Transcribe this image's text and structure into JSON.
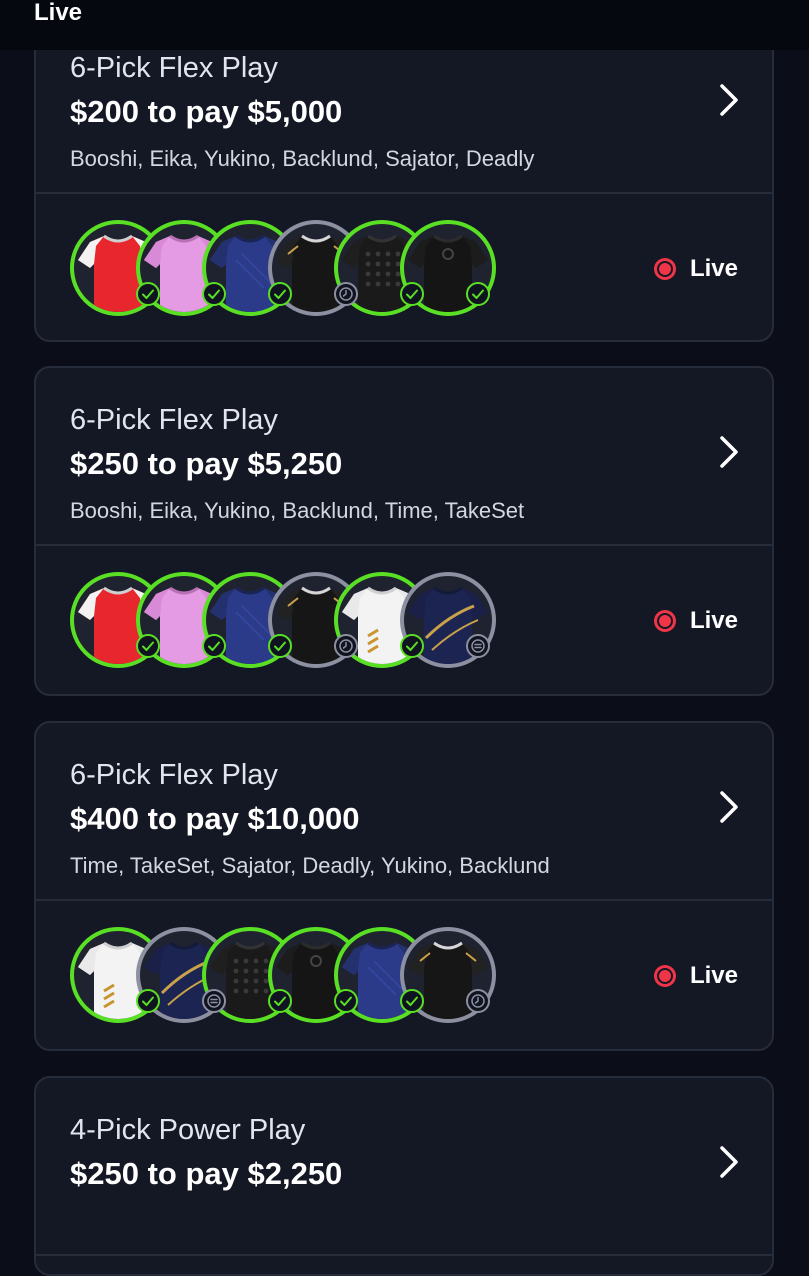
{
  "header": {
    "tab_label": "Live"
  },
  "entries": [
    {
      "play_type": "6-Pick Flex Play",
      "payout": "$200 to pay $5,000",
      "players": "Booshi, Eika, Yukino, Backlund, Sajator, Deadly",
      "status": "Live",
      "picks": [
        {
          "jersey": "red-white",
          "result": "won"
        },
        {
          "jersey": "pink",
          "result": "won"
        },
        {
          "jersey": "navy",
          "result": "won"
        },
        {
          "jersey": "black-gold",
          "result": "pending"
        },
        {
          "jersey": "black-pattern",
          "result": "won"
        },
        {
          "jersey": "black-circle",
          "result": "won"
        }
      ]
    },
    {
      "play_type": "6-Pick Flex Play",
      "payout": "$250 to pay $5,250",
      "players": "Booshi, Eika, Yukino, Backlund, Time, TakeSet",
      "status": "Live",
      "picks": [
        {
          "jersey": "red-white",
          "result": "won"
        },
        {
          "jersey": "pink",
          "result": "won"
        },
        {
          "jersey": "navy",
          "result": "won"
        },
        {
          "jersey": "black-gold",
          "result": "pending"
        },
        {
          "jersey": "white-gold",
          "result": "won"
        },
        {
          "jersey": "navy-gold",
          "result": "push"
        }
      ]
    },
    {
      "play_type": "6-Pick Flex Play",
      "payout": "$400 to pay $10,000",
      "players": "Time, TakeSet, Sajator, Deadly, Yukino, Backlund",
      "status": "Live",
      "picks": [
        {
          "jersey": "white-gold",
          "result": "won"
        },
        {
          "jersey": "navy-gold",
          "result": "push"
        },
        {
          "jersey": "black-pattern",
          "result": "won"
        },
        {
          "jersey": "black-circle",
          "result": "won"
        },
        {
          "jersey": "navy",
          "result": "won"
        },
        {
          "jersey": "black-gold",
          "result": "pending"
        }
      ]
    },
    {
      "play_type": "4-Pick Power Play",
      "payout": "$250 to pay $2,250"
    }
  ],
  "colors": {
    "background": "#0b0e18",
    "card": "#141824",
    "border": "#272c3a",
    "won": "#59e024",
    "pending": "#8c90a0",
    "live": "#f03548"
  },
  "icons": {
    "chevron": "chevron-right-icon",
    "won": "check-icon",
    "pending": "clock-icon",
    "push": "equals-icon",
    "live": "live-record-icon"
  }
}
